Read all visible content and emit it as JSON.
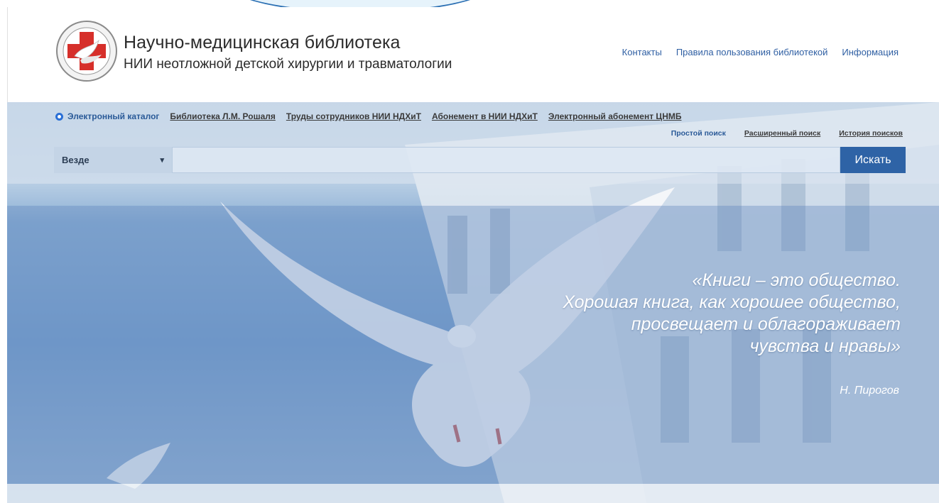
{
  "header": {
    "title": "Научно-медицинская библиотека",
    "subtitle": "НИИ неотложной детской хирургии и травматологии",
    "nav": [
      "Контакты",
      "Правила пользования библиотекой",
      "Информация"
    ]
  },
  "catalog_tabs": [
    {
      "label": "Электронный каталог",
      "active": true
    },
    {
      "label": "Библиотека Л.М. Рошаля",
      "active": false
    },
    {
      "label": "Труды сотрудников НИИ НДХиТ",
      "active": false
    },
    {
      "label": "Абонемент в НИИ НДХиТ",
      "active": false
    },
    {
      "label": "Электронный абонемент ЦНМБ",
      "active": false
    }
  ],
  "search": {
    "links": [
      "Простой поиск",
      "Расширенный поиск",
      "История поисков"
    ],
    "scope_value": "Везде",
    "query_value": "",
    "button_label": "Искать"
  },
  "quote": {
    "lines": [
      "«Книги – это общество.",
      "Хорошая книга, как хорошее общество,",
      "просвещает и облагораживает",
      "чувства и нравы»"
    ],
    "author": "Н. Пирогов"
  },
  "colors": {
    "accent": "#2e63a6",
    "link": "#2f5fa3",
    "logo_red": "#d62f2a"
  },
  "icons": {
    "logo": "medical-cross-dove-logo",
    "select": "chevron-down-icon",
    "radio": "radio-selected-icon"
  }
}
